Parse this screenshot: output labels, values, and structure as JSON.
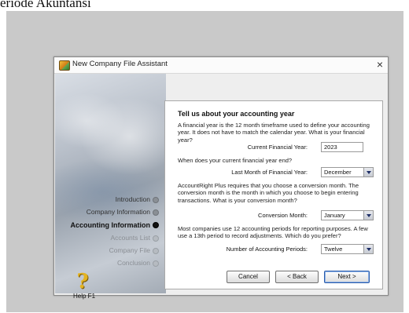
{
  "caption": "eriode Akuntansi",
  "window": {
    "title": "New Company File Assistant",
    "close_label": "×"
  },
  "sidebar": {
    "steps": [
      {
        "label": "Introduction",
        "state": "done"
      },
      {
        "label": "Company Information",
        "state": "done"
      },
      {
        "label": "Accounting Information",
        "state": "active"
      },
      {
        "label": "Accounts List",
        "state": "future"
      },
      {
        "label": "Company File",
        "state": "future"
      },
      {
        "label": "Conclusion",
        "state": "future"
      }
    ],
    "help_label": "Help F1"
  },
  "content": {
    "heading": "Tell us about your accounting year",
    "intro": "A financial year is the 12 month timeframe used to define your accounting year.  It does not have to match the calendar year.  What is your financial year?",
    "current_year_label": "Current Financial Year:",
    "current_year_value": "2023",
    "end_question": "When does your current financial year end?",
    "last_month_label": "Last Month of Financial Year:",
    "last_month_value": "December",
    "conversion_text": "AccountRight Plus requires that you choose a conversion month.  The conversion month is the month in which you choose to begin entering transactions.  What is your conversion month?",
    "conversion_label": "Conversion Month:",
    "conversion_value": "January",
    "periods_text": "Most companies use 12 accounting periods for reporting purposes.  A few use a 13th period to record adjustments.  Which do you prefer?",
    "periods_label": "Number of Accounting Periods:",
    "periods_value": "Twelve"
  },
  "buttons": {
    "cancel": "Cancel",
    "back": "< Back",
    "next": "Next >"
  }
}
